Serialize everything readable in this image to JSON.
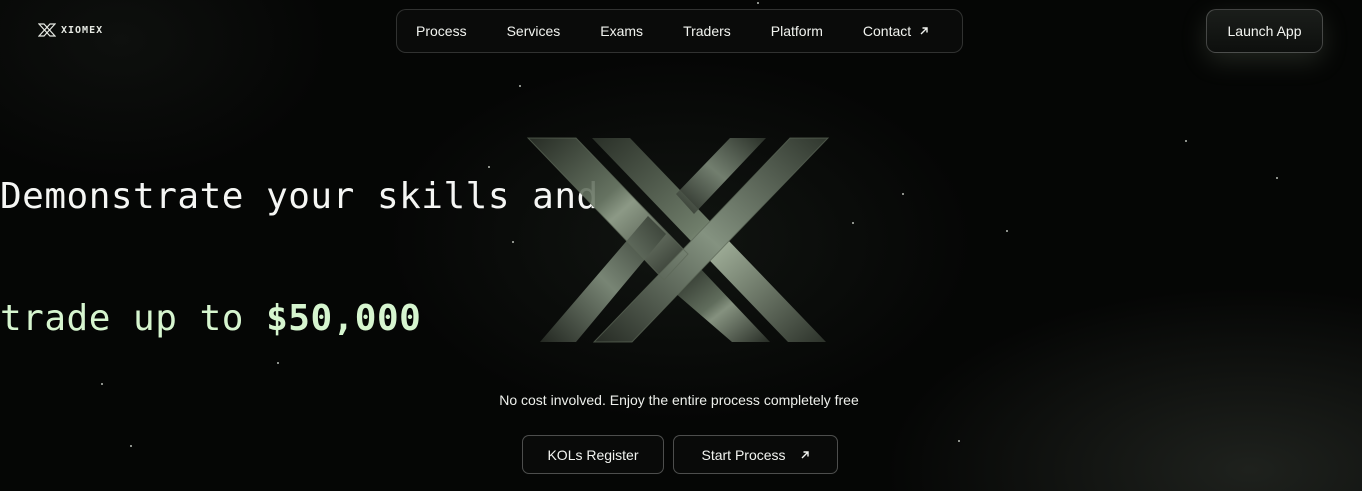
{
  "logo": {
    "text": "XIOMEX"
  },
  "nav": {
    "items": [
      {
        "label": "Process"
      },
      {
        "label": "Services"
      },
      {
        "label": "Exams"
      },
      {
        "label": "Traders"
      },
      {
        "label": "Platform"
      },
      {
        "label": "Contact",
        "icon": "arrow-up-right-icon"
      }
    ]
  },
  "header": {
    "launch_label": "Launch App"
  },
  "hero": {
    "line1": "Demonstrate your skills and",
    "line2_prefix": "trade up to ",
    "line2_amount": "$50,000",
    "tagline": "No cost involved. Enjoy the entire process completely free"
  },
  "actions": {
    "kol_label": "KOLs Register",
    "start_label": "Start Process",
    "start_icon": "arrow-up-right-icon"
  },
  "colors": {
    "background": "#050605",
    "accent_text": "#d6f5cf",
    "text": "#f5f6f4"
  }
}
